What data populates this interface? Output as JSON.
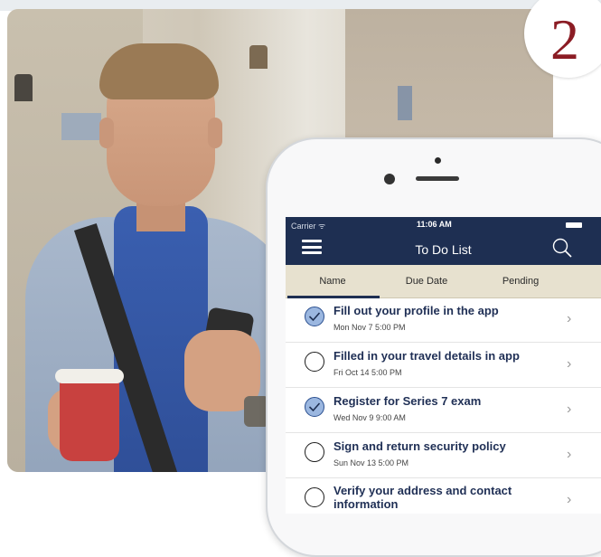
{
  "badge": {
    "number": "2"
  },
  "phone": {
    "status": {
      "carrier": "Carrier ᯤ",
      "time": "11:06 AM"
    },
    "navbar": {
      "title": "To Do List"
    },
    "tabs": [
      "Name",
      "Due Date",
      "Pending"
    ],
    "active_tab": "Name",
    "tasks": [
      {
        "title": "Fill out your profile in the app",
        "due": "Mon Nov 7 5:00 PM",
        "completed": true
      },
      {
        "title": "Filled in your travel details in app",
        "due": "Fri Oct 14 5:00 PM",
        "completed": false
      },
      {
        "title": "Register for Series 7 exam",
        "due": "Wed Nov 9 9:00 AM",
        "completed": true
      },
      {
        "title": "Sign and return security policy",
        "due": "Sun Nov 13 5:00 PM",
        "completed": false
      },
      {
        "title": "Verify your address and contact information",
        "due": "",
        "completed": false
      }
    ],
    "colors": {
      "navbar": "#1e2f52",
      "tabs_bg": "#e7e1cf",
      "task_title": "#1f2f55",
      "badge_number": "#8b1c24"
    }
  }
}
